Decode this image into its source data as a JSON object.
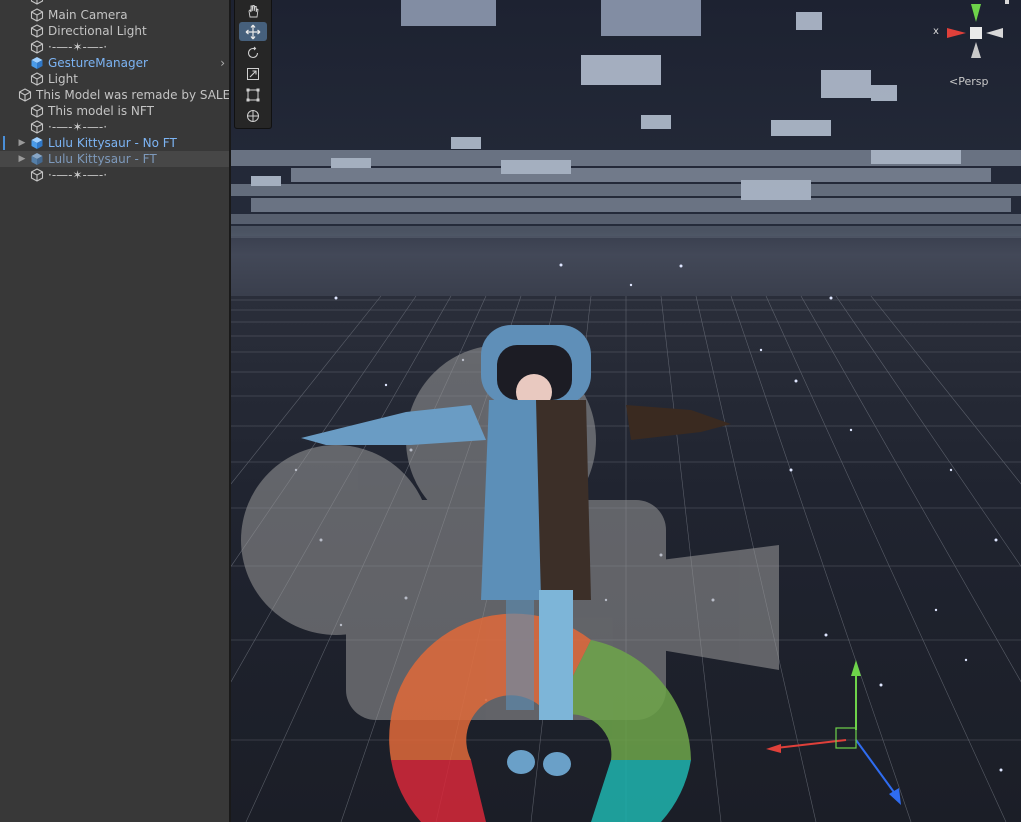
{
  "hierarchy": {
    "items": [
      {
        "label": "Main Camera",
        "type": "object"
      },
      {
        "label": "Directional Light",
        "type": "object"
      },
      {
        "label": "·-—-✶-—-·",
        "type": "object"
      },
      {
        "label": "GestureManager",
        "type": "prefab"
      },
      {
        "label": "Light",
        "type": "object"
      },
      {
        "label": "This Model was remade by SALE",
        "type": "object"
      },
      {
        "label": "This model is NFT",
        "type": "object"
      },
      {
        "label": "·-—-✶-—-·",
        "type": "object"
      },
      {
        "label": "Lulu Kittysaur - No FT",
        "type": "prefab"
      },
      {
        "label": "Lulu Kittysaur - FT",
        "type": "prefab"
      },
      {
        "label": "·-—-✶-—-·",
        "type": "object"
      }
    ]
  },
  "scene": {
    "view_mode_label": "Persp",
    "axis_label": "x",
    "tools": [
      "hand-tool",
      "move-tool",
      "rotate-tool",
      "scale-tool",
      "rect-tool",
      "transform-tool"
    ],
    "active_tool": "move-tool"
  },
  "colors": {
    "hierarchy_bg": "#383838",
    "prefab_text": "#7cb4f4",
    "text": "#c4c4c4",
    "tool_active": "#46607c",
    "axis_x": "#e0403a",
    "axis_y": "#6ed34a",
    "axis_z": "#2f6cf0"
  }
}
